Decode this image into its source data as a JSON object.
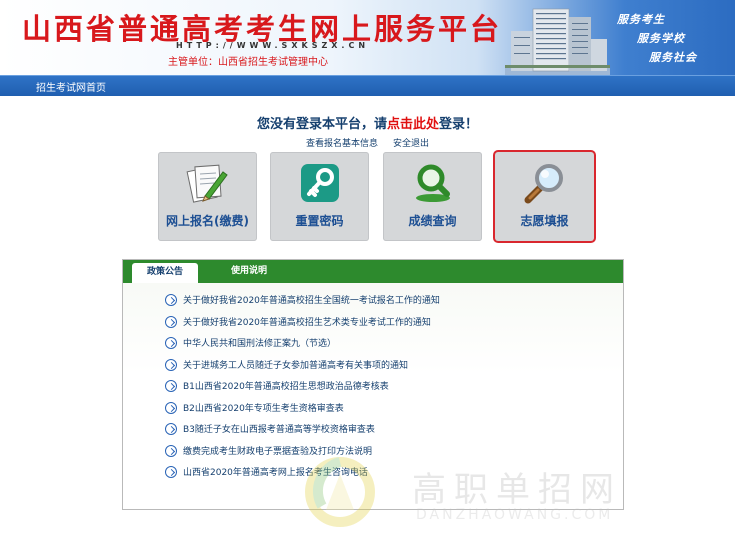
{
  "header": {
    "title": "山西省普通高考考生网上服务平台",
    "url": "HTTP://WWW.SXKSZX.CN",
    "host": "主管单位：山西省招生考试管理中心",
    "slogans": [
      "服务考生",
      "服务学校",
      "服务社会"
    ]
  },
  "nav": {
    "home": "招生考试网首页"
  },
  "login": {
    "prefix": "您没有登录本平台，请",
    "link": "点击此处",
    "suffix": "登录！"
  },
  "sub_links": [
    "查看报名基本信息",
    "安全退出"
  ],
  "tiles": [
    {
      "label": "网上报名(缴费)",
      "icon": "pen-paper-icon"
    },
    {
      "label": "重置密码",
      "icon": "key-icon"
    },
    {
      "label": "成绩查询",
      "icon": "magnifier-icon"
    },
    {
      "label": "志愿填报",
      "icon": "magnifier-icon",
      "selected": true
    }
  ],
  "tabs": [
    "政策公告",
    "使用说明"
  ],
  "notices": [
    "关于做好我省2020年普通高校招生全国统一考试报名工作的通知",
    "关于做好我省2020年普通高校招生艺术类专业考试工作的通知",
    "中华人民共和国刑法修正案九（节选）",
    "关于进城务工人员随迁子女参加普通高考有关事项的通知",
    "B1山西省2020年普通高校招生思想政治品德考核表",
    "B2山西省2020年专项生考生资格审查表",
    "B3随迁子女在山西报考普通高等学校资格审查表",
    "缴费完成考生财政电子票据查验及打印方法说明",
    "山西省2020年普通高考网上报名考生咨询电话"
  ],
  "watermark": {
    "title": "高职单招网",
    "sub": "DANZHAOWANG.COM"
  },
  "colors": {
    "title_red": "#d8181c",
    "nav_blue": "#2f73c6",
    "tab_green": "#2d8a2d",
    "link_navy": "#16406f",
    "selected_border": "#d9272e"
  }
}
